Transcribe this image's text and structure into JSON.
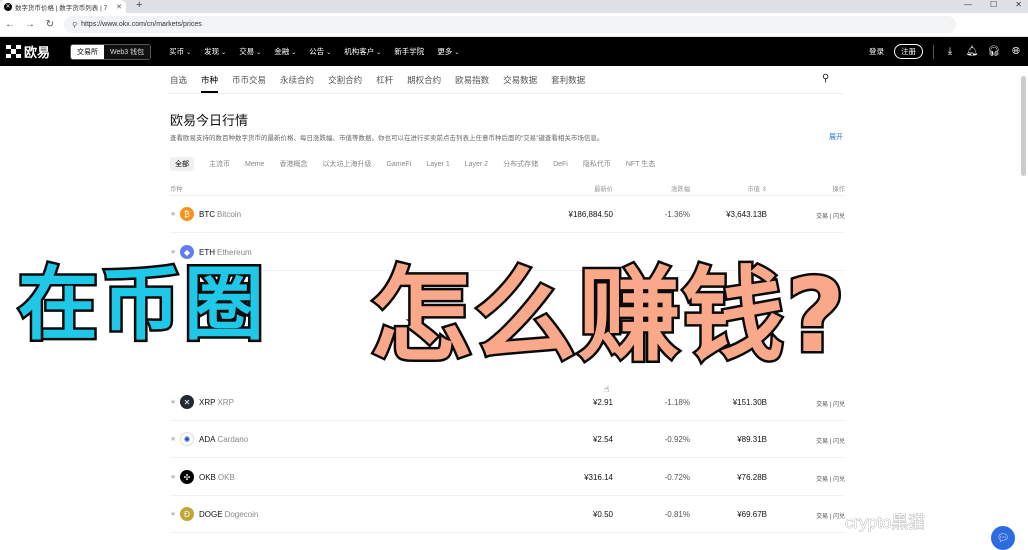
{
  "browser": {
    "tab_title": "数字货币价格 | 数字货币列表 | 7",
    "url": "https://www.okx.com/cn/markets/prices",
    "window_controls": [
      "—",
      "☐",
      "✕"
    ]
  },
  "header": {
    "logo_text": "欧易",
    "switch_on": "交易所",
    "switch_off": "Web3 钱包",
    "nav": [
      "买币",
      "发现",
      "交易",
      "金融",
      "公告",
      "机构客户",
      "新手学院",
      "更多"
    ],
    "nav_has_caret": [
      true,
      true,
      true,
      true,
      true,
      true,
      false,
      true
    ],
    "login": "登录",
    "register": "注册"
  },
  "subnav": {
    "items": [
      "自选",
      "市种",
      "币币交易",
      "永续合约",
      "交割合约",
      "杠杆",
      "期权合约",
      "欧易指数",
      "交易数据",
      "套利数据"
    ],
    "active_index": 1
  },
  "page": {
    "title": "欧易今日行情",
    "description": "查看欧易支持的数百种数字货币的最新价格、每日涨跌幅、市值等数据。你也可以在进行买卖前点击列表上任意币种后面的“交易”键查看相关市场信息。",
    "expand": "展开"
  },
  "filters": {
    "items": [
      "全部",
      "主流币",
      "Meme",
      "香港概念",
      "以太坊上海升级",
      "GameFi",
      "Layer 1",
      "Layer 2",
      "分布式存储",
      "DeFi",
      "隐私代币",
      "NFT 生态"
    ],
    "selected_index": 0
  },
  "table": {
    "headers": {
      "name": "币种",
      "price": "最新价",
      "change": "涨跌幅",
      "cap": "市值 ⇕",
      "ops": "操作"
    },
    "rows": [
      {
        "symbol": "BTC",
        "name": "Bitcoin",
        "price": "¥186,884.50",
        "change": "-1.36%",
        "cap": "¥3,643.13B",
        "trade": "交易",
        "flash": "闪兑",
        "color": "#f7931a",
        "glyph": "₿"
      },
      {
        "symbol": "ETH",
        "name": "Ethereum",
        "price": "",
        "change": "",
        "cap": "",
        "trade": "",
        "flash": "",
        "color": "#627eea",
        "glyph": "◆"
      },
      {
        "symbol": "XRP",
        "name": "XRP",
        "price": "¥2.91",
        "change": "-1.18%",
        "cap": "¥151.30B",
        "trade": "交易",
        "flash": "闪兑",
        "color": "#23292f",
        "glyph": "✕"
      },
      {
        "symbol": "ADA",
        "name": "Cardano",
        "price": "¥2.54",
        "change": "-0.92%",
        "cap": "¥89.31B",
        "trade": "交易",
        "flash": "闪兑",
        "color": "#ffffff",
        "glyph": "✺"
      },
      {
        "symbol": "OKB",
        "name": "OKB",
        "price": "¥316.14",
        "change": "-0.72%",
        "cap": "¥76.28B",
        "trade": "交易",
        "flash": "闪兑",
        "color": "#000000",
        "glyph": "✣"
      },
      {
        "symbol": "DOGE",
        "name": "Dogecoin",
        "price": "¥0.50",
        "change": "-0.81%",
        "cap": "¥69.67B",
        "trade": "交易",
        "flash": "闪兑",
        "color": "#c2a633",
        "glyph": "Ð"
      }
    ]
  },
  "overlay": {
    "part1": "在币圈",
    "part2": "怎么赚钱?"
  },
  "watermark": "crypto黑猫",
  "colors": {
    "overlay_cyan": "#1ec8e6",
    "overlay_salmon": "#f9a88a",
    "link_blue": "#3a6fd8"
  }
}
